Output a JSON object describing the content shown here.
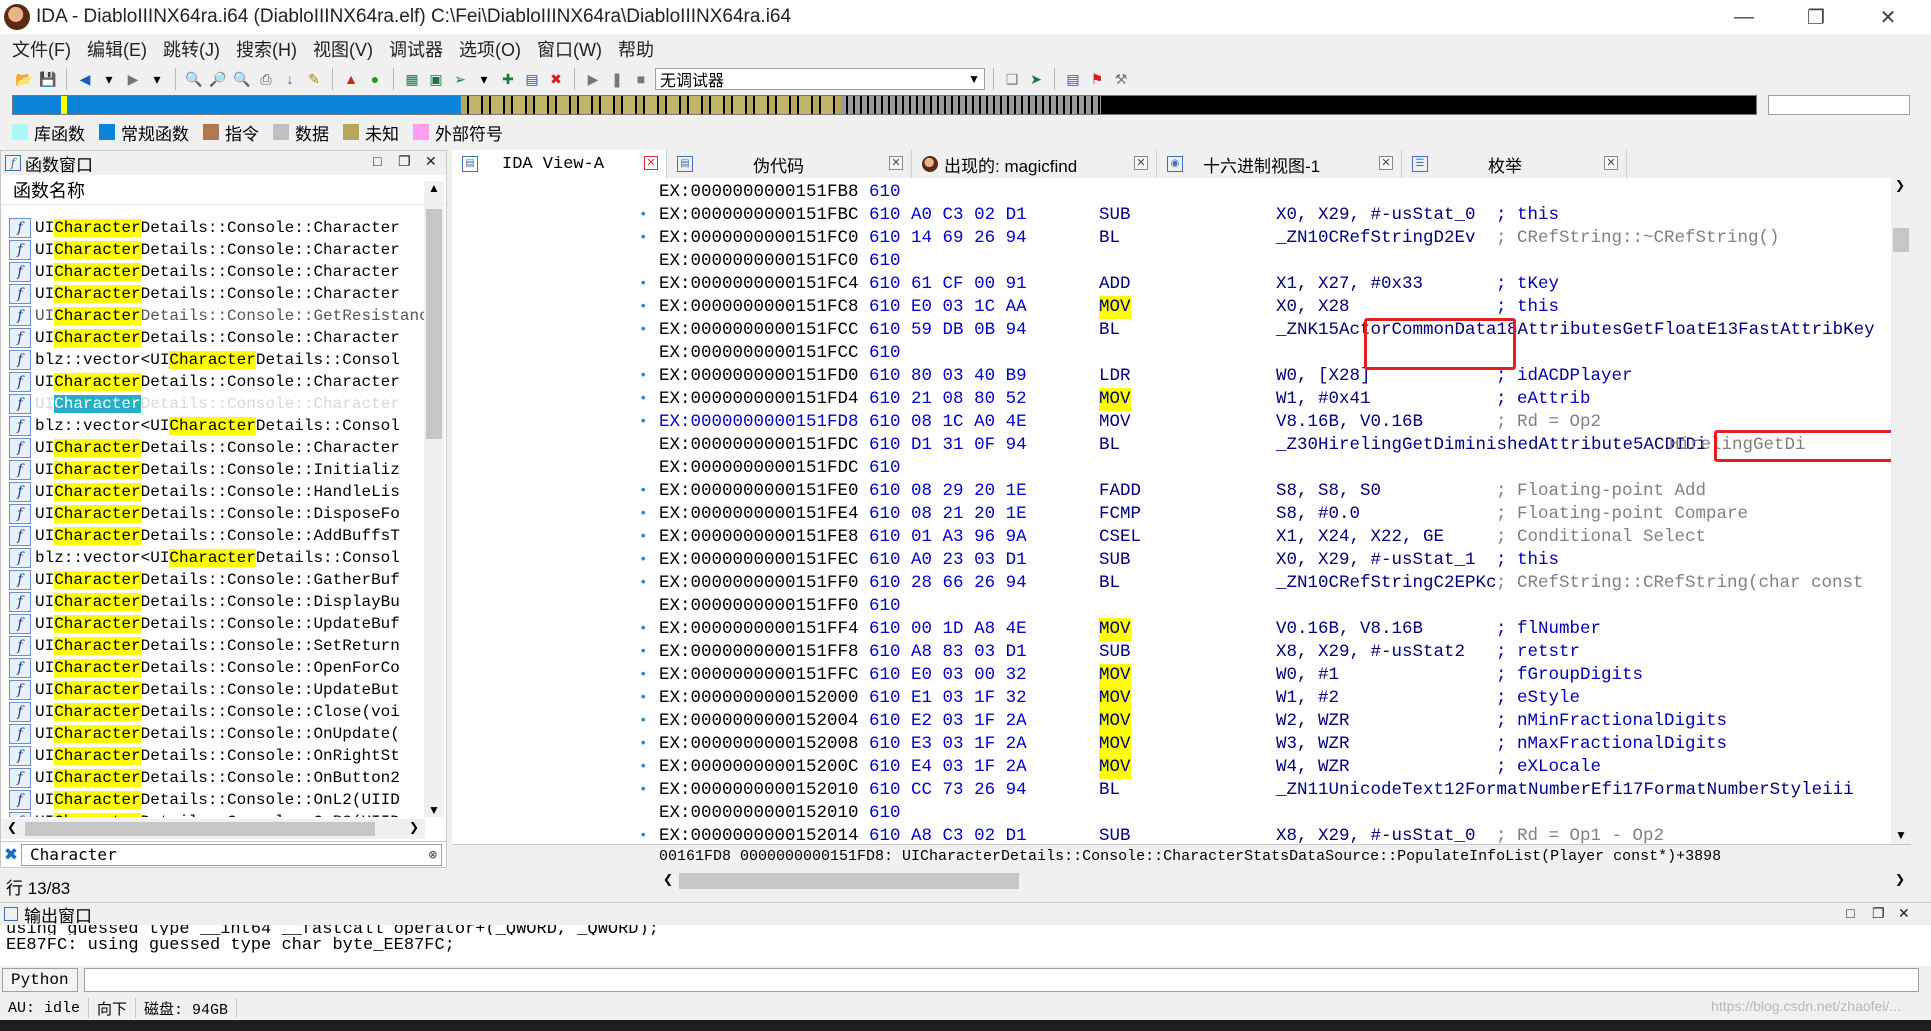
{
  "window": {
    "title": "IDA - DiabloIIINX64ra.i64 (DiabloIIINX64ra.elf) C:\\Fei\\DiabloIIINX64ra\\DiabloIIINX64ra.i64",
    "minimize": "—",
    "restore": "❐",
    "close": "✕"
  },
  "menu": [
    "文件(F)",
    "编辑(E)",
    "跳转(J)",
    "搜索(H)",
    "视图(V)",
    "调试器",
    "选项(O)",
    "窗口(W)",
    "帮助"
  ],
  "toolbar": {
    "debugger_select": "无调试器"
  },
  "legend": [
    {
      "label": "库函数",
      "color": "#aaf8f8"
    },
    {
      "label": "常规函数",
      "color": "#0a84d8"
    },
    {
      "label": "指令",
      "color": "#b07850"
    },
    {
      "label": "数据",
      "color": "#c0c0c0"
    },
    {
      "label": "未知",
      "color": "#b5a85a"
    },
    {
      "label": "外部符号",
      "color": "#ff9cf4"
    }
  ],
  "functions_panel": {
    "title": "函数窗口",
    "column": "函数名称",
    "filter_value": "Character",
    "line_status": "行 13/83",
    "rows": [
      {
        "pre": "UI",
        "hl": "Character",
        "post": "Details::Console::Character"
      },
      {
        "pre": "UI",
        "hl": "Character",
        "post": "Details::Console::Character"
      },
      {
        "pre": "UI",
        "hl": "Character",
        "post": "Details::Console::Character"
      },
      {
        "pre": "UI",
        "hl": "Character",
        "post": "Details::Console::Character"
      },
      {
        "pre": "UI",
        "hl": "Character",
        "post": "Details::Console::GetResistance"
      },
      {
        "pre": "UI",
        "hl": "Character",
        "post": "Details::Console::Character"
      },
      {
        "pre": "blz::vector<UI",
        "hl": "Character",
        "post": "Details::Consol"
      },
      {
        "pre": "UI",
        "hl": "Character",
        "post": "Details::Console::Character"
      },
      {
        "pre": "UI",
        "hl": "Character",
        "post": "Details::Console::Character"
      },
      {
        "pre": "blz::vector<UI",
        "hl": "Character",
        "post": "Details::Consol"
      },
      {
        "pre": "UI",
        "hl": "Character",
        "post": "Details::Console::Character"
      },
      {
        "pre": "UI",
        "hl": "Character",
        "post": "Details::Console::Initializ"
      },
      {
        "pre": "UI",
        "hl": "Character",
        "post": "Details::Console::HandleLis"
      },
      {
        "pre": "UI",
        "hl": "Character",
        "post": "Details::Console::DisposeFo"
      },
      {
        "pre": "UI",
        "hl": "Character",
        "post": "Details::Console::AddBuffsT"
      },
      {
        "pre": "blz::vector<UI",
        "hl": "Character",
        "post": "Details::Consol"
      },
      {
        "pre": "UI",
        "hl": "Character",
        "post": "Details::Console::GatherBuf"
      },
      {
        "pre": "UI",
        "hl": "Character",
        "post": "Details::Console::DisplayBu"
      },
      {
        "pre": "UI",
        "hl": "Character",
        "post": "Details::Console::UpdateBuf"
      },
      {
        "pre": "UI",
        "hl": "Character",
        "post": "Details::Console::SetReturn"
      },
      {
        "pre": "UI",
        "hl": "Character",
        "post": "Details::Console::OpenForCo"
      },
      {
        "pre": "UI",
        "hl": "Character",
        "post": "Details::Console::UpdateBut"
      },
      {
        "pre": "UI",
        "hl": "Character",
        "post": "Details::Console::Close(voi"
      },
      {
        "pre": "UI",
        "hl": "Character",
        "post": "Details::Console::OnUpdate("
      },
      {
        "pre": "UI",
        "hl": "Character",
        "post": "Details::Console::OnRightSt"
      },
      {
        "pre": "UI",
        "hl": "Character",
        "post": "Details::Console::OnButton2"
      },
      {
        "pre": "UI",
        "hl": "Character",
        "post": "Details::Console::OnL2(UIID"
      },
      {
        "pre": "UI",
        "hl": "Character",
        "post": "Details::Console::OnR2(UIID"
      }
    ]
  },
  "tabs": [
    {
      "label": "IDA View-A",
      "active": true
    },
    {
      "label": "伪代码",
      "active": false
    },
    {
      "label": "出现的: magicfind",
      "active": false
    },
    {
      "label": "十六进制视图-1",
      "active": false
    },
    {
      "label": "枚举",
      "active": false
    }
  ],
  "disasm": {
    "status": "00161FD8  0000000000151FD8: UICharacterDetails::Console::CharacterStatsDataSource::PopulateInfoList(Player const*)+3898",
    "lines": [
      {
        "addr": "EX:0000000000151FB8",
        "bytes": " 610",
        "mnem": "",
        "ops": "",
        "cmt": "",
        "dot": false
      },
      {
        "addr": "EX:0000000000151FBC",
        "bytes": " 610 A0 C3 02 D1",
        "mnem": "SUB",
        "ops": "X0, X29, #-usStat_0",
        "cmt": "; this",
        "dot": true
      },
      {
        "addr": "EX:0000000000151FC0",
        "bytes": " 610 14 69 26 94",
        "mnem": "BL",
        "ops": "_ZN10CRefStringD2Ev",
        "cmt": "; CRefString::~CRefString()",
        "cmtgray": true,
        "dot": true
      },
      {
        "addr": "EX:0000000000151FC0",
        "bytes": " 610",
        "mnem": "",
        "ops": "",
        "cmt": "",
        "dot": false
      },
      {
        "addr": "EX:0000000000151FC4",
        "bytes": " 610 61 CF 00 91",
        "mnem": "ADD",
        "ops": "X1, X27, #0x33",
        "cmt": "; tKey",
        "dot": true
      },
      {
        "addr": "EX:0000000000151FC8",
        "bytes": " 610 E0 03 1C AA",
        "mnem": "MOV",
        "ops": "X0, X28",
        "cmt": "; this",
        "dot": true,
        "hl": true
      },
      {
        "addr": "EX:0000000000151FCC",
        "bytes": " 610 59 DB 0B 94",
        "mnem": "BL",
        "ops": "_ZNK15ActorCommonData18AttributesGetFloatE13FastAttribKey",
        "cmt": "",
        "dot": true
      },
      {
        "addr": "EX:0000000000151FCC",
        "bytes": " 610",
        "mnem": "",
        "ops": "",
        "cmt": "",
        "dot": false
      },
      {
        "addr": "EX:0000000000151FD0",
        "bytes": " 610 80 03 40 B9",
        "mnem": "LDR",
        "ops": "W0, [X28]",
        "cmt": "; idACDPlayer",
        "dot": true
      },
      {
        "addr": "EX:0000000000151FD4",
        "bytes": " 610 21 08 80 52",
        "mnem": "MOV",
        "ops": "W1, #0x41",
        "cmt": "; eAttrib",
        "dot": true,
        "hl": true
      },
      {
        "addr": "EX:0000000000151FD8",
        "bytes": " 610 08 1C A0 4E",
        "mnem": "MOV",
        "ops": "V8.16B, V0.16B",
        "cmt": "; Rd = Op2",
        "cmtgray": true,
        "dot": true,
        "cur": true
      },
      {
        "addr": "EX:0000000000151FDC",
        "bytes": " 610 D1 31 0F 94",
        "mnem": "BL",
        "ops": "_Z30HirelingGetDiminishedAttribute5ACDIDi",
        "cmt": "",
        "extra": "HirelingGetDi",
        "dot": false
      },
      {
        "addr": "EX:0000000000151FDC",
        "bytes": " 610",
        "mnem": "",
        "ops": "",
        "cmt": "",
        "dot": false
      },
      {
        "addr": "EX:0000000000151FE0",
        "bytes": " 610 08 29 20 1E",
        "mnem": "FADD",
        "ops": "S8, S8, S0",
        "cmt": "; Floating-point Add",
        "cmtgray": true,
        "dot": true
      },
      {
        "addr": "EX:0000000000151FE4",
        "bytes": " 610 08 21 20 1E",
        "mnem": "FCMP",
        "ops": "S8, #0.0",
        "cmt": "; Floating-point Compare",
        "cmtgray": true,
        "dot": true
      },
      {
        "addr": "EX:0000000000151FE8",
        "bytes": " 610 01 A3 96 9A",
        "mnem": "CSEL",
        "ops": "X1, X24, X22, GE",
        "cmt": "; Conditional Select",
        "cmtgray": true,
        "dot": true
      },
      {
        "addr": "EX:0000000000151FEC",
        "bytes": " 610 A0 23 03 D1",
        "mnem": "SUB",
        "ops": "X0, X29, #-usStat_1",
        "cmt": "; this",
        "dot": true
      },
      {
        "addr": "EX:0000000000151FF0",
        "bytes": " 610 28 66 26 94",
        "mnem": "BL",
        "ops": "_ZN10CRefStringC2EPKc",
        "cmt": "; CRefString::CRefString(char const",
        "cmtgray": true,
        "dot": true
      },
      {
        "addr": "EX:0000000000151FF0",
        "bytes": " 610",
        "mnem": "",
        "ops": "",
        "cmt": "",
        "dot": false
      },
      {
        "addr": "EX:0000000000151FF4",
        "bytes": " 610 00 1D A8 4E",
        "mnem": "MOV",
        "ops": "V0.16B, V8.16B",
        "cmt": "; flNumber",
        "dot": true,
        "hl": true
      },
      {
        "addr": "EX:0000000000151FF8",
        "bytes": " 610 A8 83 03 D1",
        "mnem": "SUB",
        "ops": "X8, X29, #-usStat2",
        "cmt": "; retstr",
        "dot": true
      },
      {
        "addr": "EX:0000000000151FFC",
        "bytes": " 610 E0 03 00 32",
        "mnem": "MOV",
        "ops": "W0, #1",
        "cmt": "; fGroupDigits",
        "dot": true,
        "hl": true
      },
      {
        "addr": "EX:0000000000152000",
        "bytes": " 610 E1 03 1F 32",
        "mnem": "MOV",
        "ops": "W1, #2",
        "cmt": "; eStyle",
        "dot": true,
        "hl": true
      },
      {
        "addr": "EX:0000000000152004",
        "bytes": " 610 E2 03 1F 2A",
        "mnem": "MOV",
        "ops": "W2, WZR",
        "cmt": "; nMinFractionalDigits",
        "dot": true,
        "hl": true
      },
      {
        "addr": "EX:0000000000152008",
        "bytes": " 610 E3 03 1F 2A",
        "mnem": "MOV",
        "ops": "W3, WZR",
        "cmt": "; nMaxFractionalDigits",
        "dot": true,
        "hl": true
      },
      {
        "addr": "EX:000000000015200C",
        "bytes": " 610 E4 03 1F 2A",
        "mnem": "MOV",
        "ops": "W4, WZR",
        "cmt": "; eXLocale",
        "dot": true,
        "hl": true
      },
      {
        "addr": "EX:0000000000152010",
        "bytes": " 610 CC 73 26 94",
        "mnem": "BL",
        "ops": "_ZN11UnicodeText12FormatNumberEfi17FormatNumberStyleiii",
        "cmt": "",
        "dot": true
      },
      {
        "addr": "EX:0000000000152010",
        "bytes": " 610",
        "mnem": "",
        "ops": "",
        "cmt": "",
        "dot": false
      },
      {
        "addr": "EX:0000000000152014",
        "bytes": " 610 A8 C3 02 D1",
        "mnem": "SUB",
        "ops": "X8, X29, #-usStat_0",
        "cmt": "; Rd = Op1 - Op2",
        "cmtgray": true,
        "dot": true
      }
    ]
  },
  "output": {
    "title": "输出窗口",
    "partial_line": "using guessed type __int64 __fastcall operator+(_QWORD, _QWORD);",
    "line": "EE87FC: using guessed type char byte_EE87FC;",
    "python_label": "Python"
  },
  "status": {
    "au": "AU:  idle",
    "dir": "向下",
    "disk": "磁盘: 94GB"
  },
  "watermark": "https://blog.csdn.net/zhaofei/..."
}
